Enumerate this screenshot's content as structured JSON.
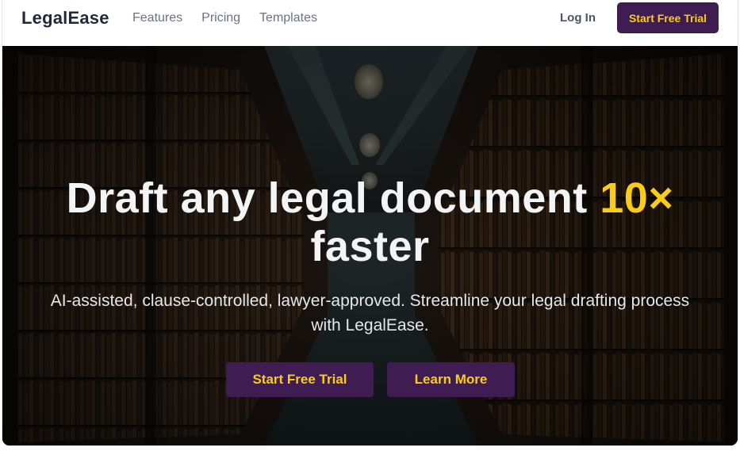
{
  "navbar": {
    "brand": "LegalEase",
    "links": [
      "Features",
      "Pricing",
      "Templates"
    ],
    "login": "Log In",
    "cta": "Start Free Trial"
  },
  "hero": {
    "headline_main": "Draft any legal document",
    "headline_accent": "10×",
    "headline_end": "faster",
    "subtext": "AI-assisted, clause-controlled, lawyer-approved. Streamline your legal drafting process with LegalEase.",
    "primary_button": "Start Free Trial",
    "secondary_button": "Learn More",
    "background_image": "library-bookshelves-photo"
  },
  "colors": {
    "brand_purple": "#3f1d52",
    "accent_yellow": "#facc15"
  }
}
